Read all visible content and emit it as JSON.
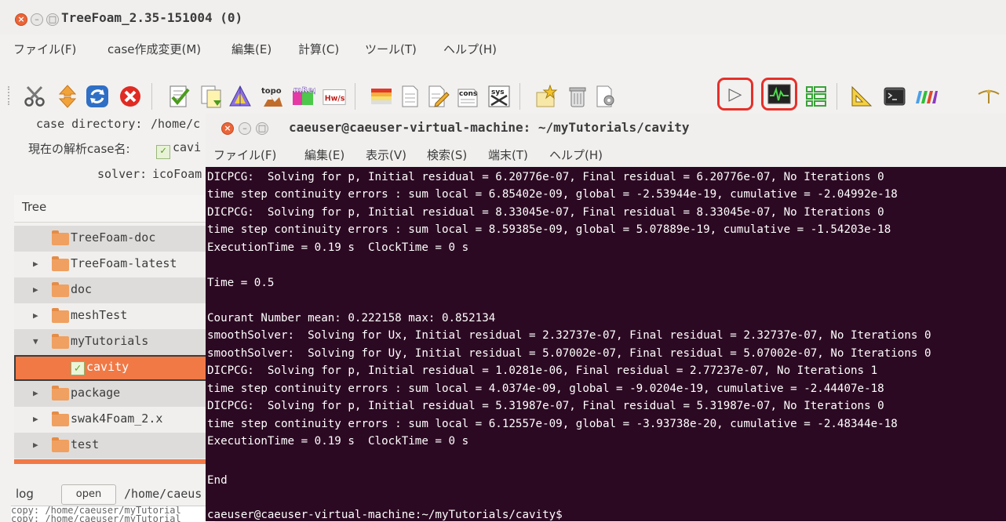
{
  "window": {
    "title": "TreeFoam_2.35-151004 (0)",
    "close_glyph": "×",
    "min_glyph": "–",
    "max_glyph": "□"
  },
  "menubar": {
    "items": [
      "ファイル(F)",
      "case作成変更(M)",
      "編集(E)",
      "計算(C)",
      "ツール(T)",
      "ヘルプ(H)"
    ]
  },
  "toolbar": {
    "icons": [
      "scissors-icon",
      "up-down-arrow-icon",
      "refresh-icon",
      "stop-icon",
      "checklist-icon",
      "copy-case-icon",
      "mesh-triangle-icon",
      "topo-icon",
      "mreg-icon",
      "hwos-icon",
      "grid-table-icon",
      "document-icon",
      "edit-document-icon",
      "cons-icon",
      "sys-icon",
      "star-folder-icon",
      "trash-icon",
      "run-play-icon",
      "plot-residual-icon",
      "grid-layout-icon",
      "ruler-icon",
      "terminal-icon",
      "paraview-icon",
      "wing-icon"
    ],
    "text_labels": {
      "topo": "topo",
      "mreg": "mReg",
      "hwos": "Hw/s",
      "cons": "cons",
      "sys": "sys"
    },
    "play_glyph": "▷"
  },
  "case_info": {
    "dir_label": "case directory:",
    "dir_value": "/home/c",
    "case_label": "現在の解析case名:",
    "case_value": "cavi",
    "solver_label": "solver:",
    "solver_value": "icoFoam"
  },
  "tree": {
    "header": "Tree",
    "expanded_glyph": "▼",
    "collapsed_glyph": "▶",
    "check_glyph": "✓",
    "items": [
      {
        "label": "TreeFoam-doc"
      },
      {
        "label": "TreeFoam-latest"
      },
      {
        "label": "doc"
      },
      {
        "label": "meshTest"
      },
      {
        "label": "myTutorials"
      },
      {
        "label": "cavity"
      },
      {
        "label": "package"
      },
      {
        "label": "swak4Foam_2.x"
      },
      {
        "label": "test"
      }
    ]
  },
  "log": {
    "label": "log",
    "open_button": "open",
    "path": "/home/caeus",
    "lines": [
      "copy: /home/caeuser/myTutorial",
      "copy: /home/caeuser/myTutorial"
    ]
  },
  "terminal": {
    "title": "caeuser@caeuser-virtual-machine: ~/myTutorials/cavity",
    "menu": [
      "ファイル(F)",
      "編集(E)",
      "表示(V)",
      "検索(S)",
      "端末(T)",
      "ヘルプ(H)"
    ],
    "lines": [
      "DICPCG:  Solving for p, Initial residual = 6.20776e-07, Final residual = 6.20776e-07, No Iterations 0",
      "time step continuity errors : sum local = 6.85402e-09, global = -2.53944e-19, cumulative = -2.04992e-18",
      "DICPCG:  Solving for p, Initial residual = 8.33045e-07, Final residual = 8.33045e-07, No Iterations 0",
      "time step continuity errors : sum local = 8.59385e-09, global = 5.07889e-19, cumulative = -1.54203e-18",
      "ExecutionTime = 0.19 s  ClockTime = 0 s",
      "",
      "Time = 0.5",
      "",
      "Courant Number mean: 0.222158 max: 0.852134",
      "smoothSolver:  Solving for Ux, Initial residual = 2.32737e-07, Final residual = 2.32737e-07, No Iterations 0",
      "smoothSolver:  Solving for Uy, Initial residual = 5.07002e-07, Final residual = 5.07002e-07, No Iterations 0",
      "DICPCG:  Solving for p, Initial residual = 1.0281e-06, Final residual = 2.77237e-07, No Iterations 1",
      "time step continuity errors : sum local = 4.0374e-09, global = -9.0204e-19, cumulative = -2.44407e-18",
      "DICPCG:  Solving for p, Initial residual = 5.31987e-07, Final residual = 5.31987e-07, No Iterations 0",
      "time step continuity errors : sum local = 6.12557e-09, global = -3.93738e-20, cumulative = -2.48344e-18",
      "ExecutionTime = 0.19 s  ClockTime = 0 s",
      "",
      "End",
      "",
      "caeuser@caeuser-virtual-machine:~/myTutorials/cavity$"
    ]
  },
  "colors": {
    "terminal_bg": "#2c0922",
    "selection": "#f07946",
    "highlight": "#e6302a"
  }
}
